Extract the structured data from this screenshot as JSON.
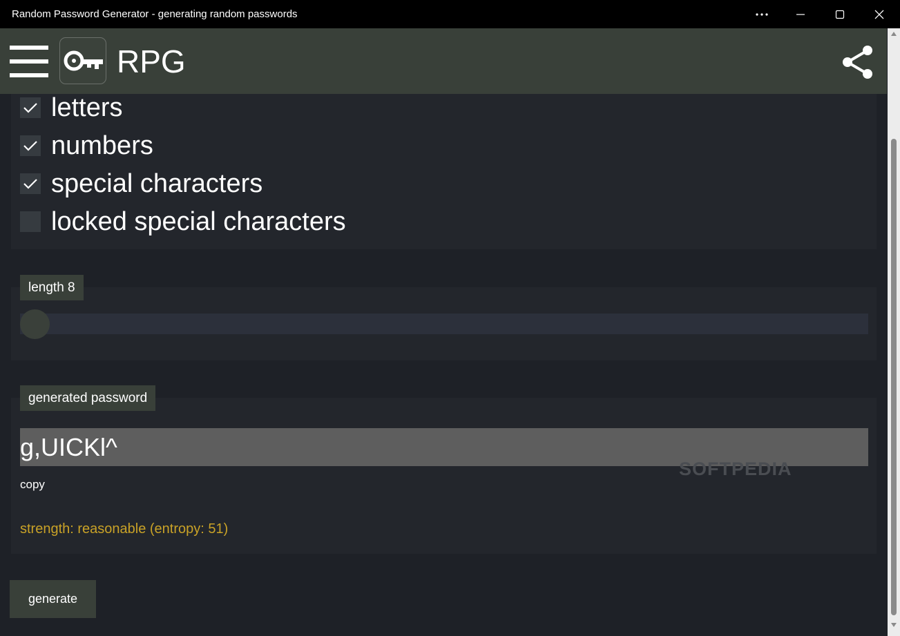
{
  "window": {
    "title": "Random Password Generator - generating random passwords"
  },
  "app": {
    "title": "RPG",
    "logo_icon": "key-icon",
    "menu_icon": "hamburger-menu-icon",
    "share_icon": "share-icon"
  },
  "options": [
    {
      "label": "letters",
      "checked": true
    },
    {
      "label": "numbers",
      "checked": true
    },
    {
      "label": "special characters",
      "checked": true
    },
    {
      "label": "locked special characters",
      "checked": false
    }
  ],
  "length": {
    "label": "length 8",
    "value": 8
  },
  "password": {
    "label": "generated password",
    "value": "g,UICKl^",
    "copy_label": "copy",
    "strength": "strength: reasonable (entropy: 51)"
  },
  "generate_label": "generate",
  "watermark": "SOFTPEDIA",
  "colors": {
    "accent": "#394039",
    "strength": "#c9a227",
    "background": "#1e2127"
  }
}
